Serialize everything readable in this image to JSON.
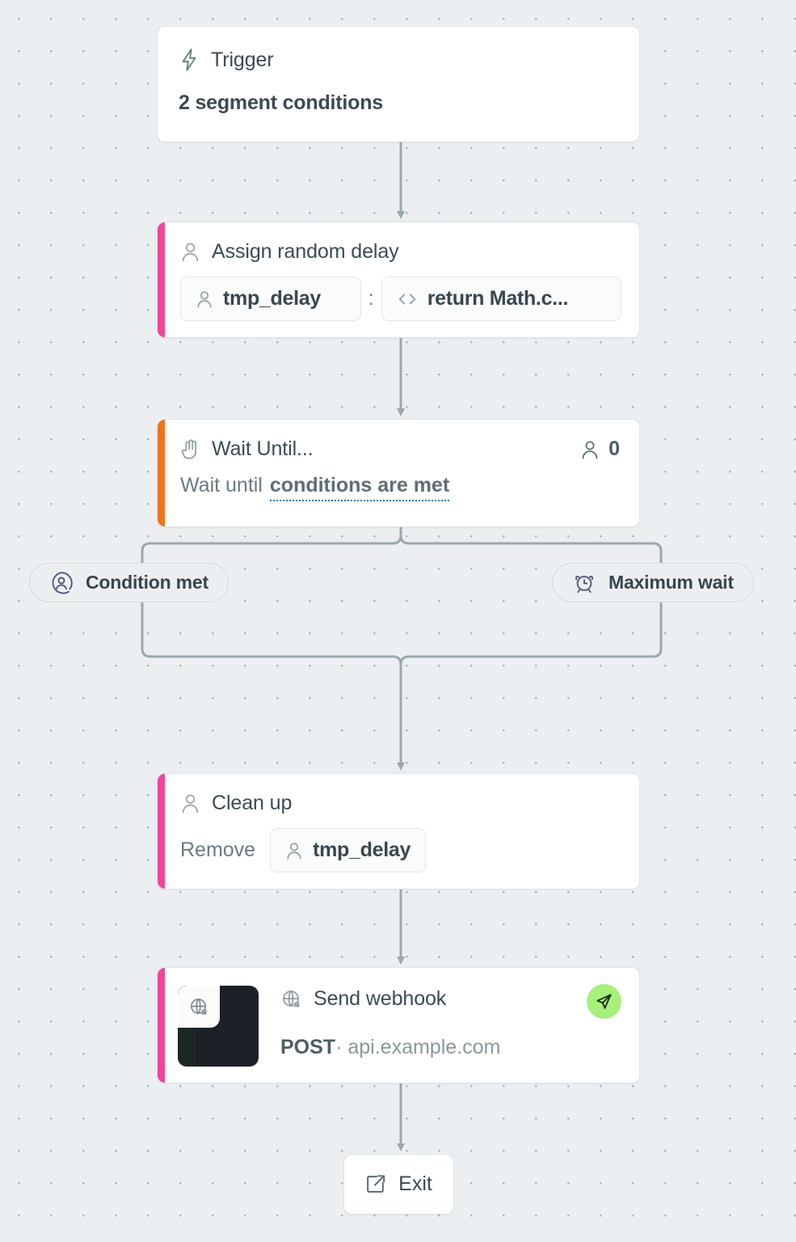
{
  "canvas": {
    "background": "#eceff1",
    "dot_color": "#a9b4b9",
    "edge_color": "#9aa9af"
  },
  "nodes": {
    "trigger": {
      "icon": "lightning-bolt-icon",
      "title": "Trigger",
      "subtitle": "2 segment conditions"
    },
    "assign_delay": {
      "accent_color": "#f0459a",
      "icon": "person-icon",
      "title": "Assign random delay",
      "attribute_chip": {
        "icon": "person-icon",
        "label": "tmp_delay"
      },
      "separator": ":",
      "value_chip": {
        "icon": "code-brackets-icon",
        "label": "return Math.c..."
      }
    },
    "wait_until": {
      "accent_color": "#f2711c",
      "icon": "hand-raised-icon",
      "title": "Wait Until...",
      "count_icon": "person-icon",
      "count": "0",
      "body_prefix": "Wait until",
      "body_link": "conditions are met"
    },
    "branches": [
      {
        "icon": "person-in-circle-icon",
        "label": "Condition met"
      },
      {
        "icon": "alarm-clock-icon",
        "label": "Maximum wait"
      }
    ],
    "clean_up": {
      "accent_color": "#f0459a",
      "icon": "person-icon",
      "title": "Clean up",
      "action_label": "Remove",
      "attribute_chip": {
        "icon": "person-icon",
        "label": "tmp_delay"
      }
    },
    "send_webhook": {
      "accent_color": "#f0459a",
      "thumbnail_color": "#1c2128",
      "thumbnail_badge_icon": "globe-icon",
      "icon": "globe-icon",
      "title": "Send webhook",
      "method": "POST",
      "separator": "·",
      "host": "api.example.com",
      "status_badge": {
        "icon": "paper-plane-icon",
        "color": "#a8f07c"
      }
    },
    "exit": {
      "icon": "external-link-icon",
      "label": "Exit"
    }
  }
}
